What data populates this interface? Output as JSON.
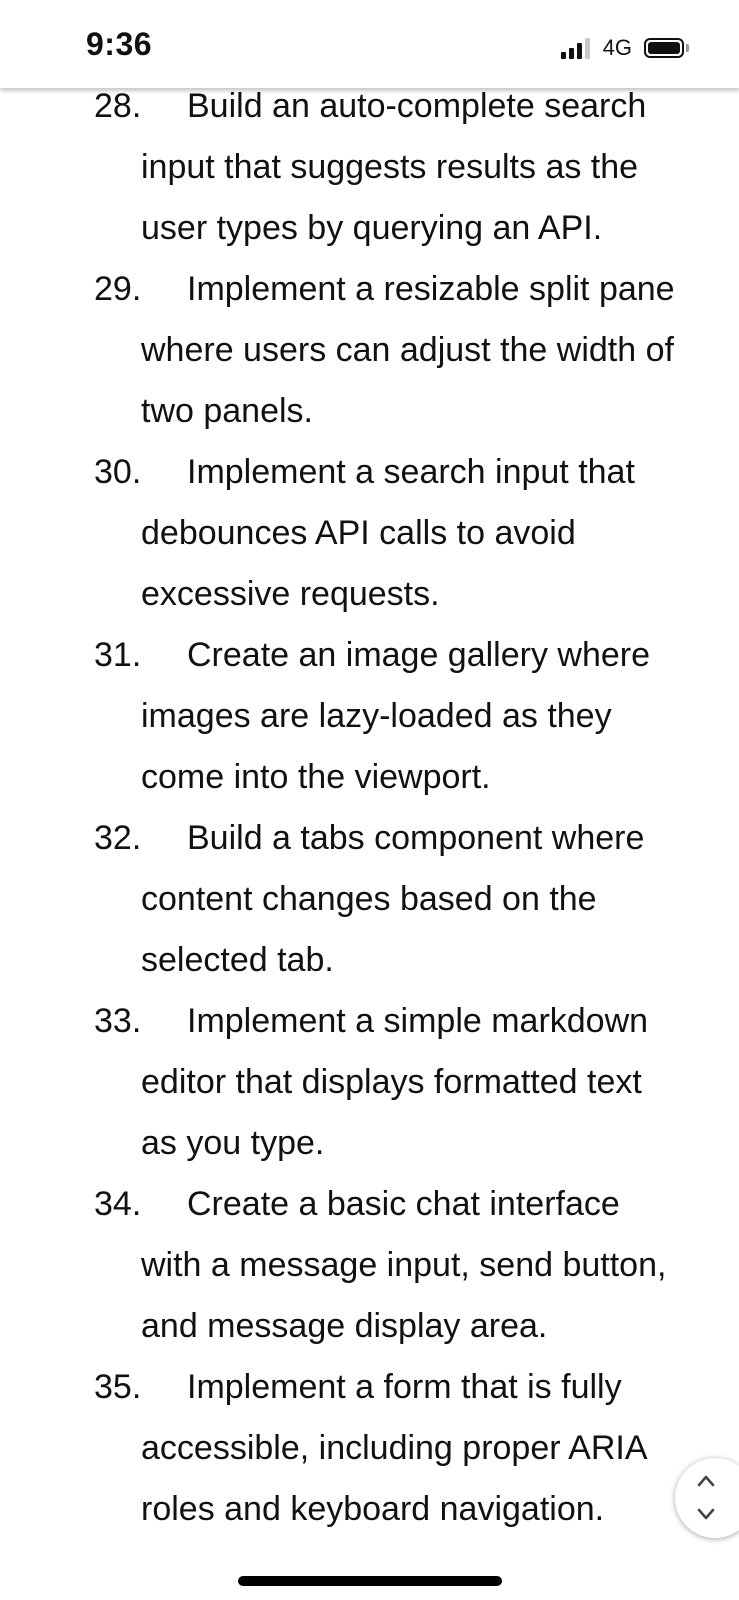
{
  "status_bar": {
    "time": "9:36",
    "network": "4G"
  },
  "list": {
    "items": [
      {
        "number": "28.",
        "text": "Build an auto-complete search input that suggests results as the user types by querying an API."
      },
      {
        "number": "29.",
        "text": "Implement a resizable split pane where users can adjust the width of two panels."
      },
      {
        "number": "30.",
        "text": "Implement a search input that debounces API calls to avoid excessive requests."
      },
      {
        "number": "31.",
        "text": "Create an image gallery where images are lazy-loaded as they come into the viewport."
      },
      {
        "number": "32.",
        "text": "Build a tabs component where content changes based on the selected tab."
      },
      {
        "number": "33.",
        "text": "Implement a simple markdown editor that displays formatted text as you type."
      },
      {
        "number": "34.",
        "text": "Create a basic chat interface with a message input, send button, and message display area."
      },
      {
        "number": "35.",
        "text": "Implement a form that is fully accessible, including proper ARIA roles and keyboard navigation."
      }
    ]
  },
  "icons": {
    "signal": "signal-icon",
    "battery": "battery-icon",
    "scroll_up": "chevron-up-icon",
    "scroll_down": "chevron-down-icon"
  }
}
